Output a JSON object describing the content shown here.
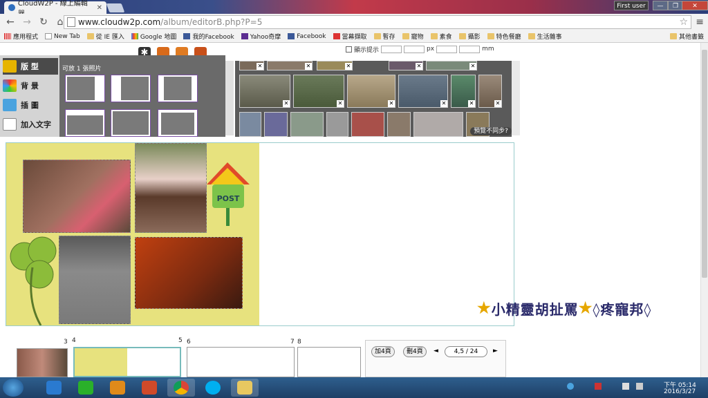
{
  "browser": {
    "tab_title": "CloudW2P - 線上編輯器",
    "url_host": "www.cloudw2p.com",
    "url_path": "/album/editorB.php?P=5",
    "user_button": "First user",
    "win_min": "—",
    "win_max": "❐",
    "win_close": "✕"
  },
  "bookmarks": [
    {
      "label": "應用程式",
      "icon": "apps-icon"
    },
    {
      "label": "New Tab",
      "icon": "page-icon"
    },
    {
      "label": "從 IE 匯入",
      "icon": "folder-icon"
    },
    {
      "label": "Google 地圖",
      "icon": "google-icon"
    },
    {
      "label": "我的Facebook",
      "icon": "facebook-icon"
    },
    {
      "label": "Yahoo奇摩",
      "icon": "yahoo-icon"
    },
    {
      "label": "Facebook",
      "icon": "facebook-icon"
    },
    {
      "label": "當幕擷取",
      "icon": "home-icon"
    },
    {
      "label": "暫存",
      "icon": "folder-icon"
    },
    {
      "label": "寵物",
      "icon": "folder-icon"
    },
    {
      "label": "素食",
      "icon": "folder-icon"
    },
    {
      "label": "攝影",
      "icon": "folder-icon"
    },
    {
      "label": "特色餐廳",
      "icon": "folder-icon"
    },
    {
      "label": "生活雜事",
      "icon": "folder-icon"
    }
  ],
  "other_bookmarks": "其他書籤",
  "editor": {
    "show_tips": "顯示提示",
    "unit_px": "px",
    "unit_mm": "mm",
    "nav": [
      {
        "label": "版 型"
      },
      {
        "label": "背 景"
      },
      {
        "label": "插 圖"
      },
      {
        "label": "加入文字"
      }
    ],
    "layout_caption": "可放 1 張照片",
    "preview_label": "預覽不同步?",
    "post_label": "POST"
  },
  "pages": {
    "numbers": [
      "3",
      "4",
      "5",
      "6",
      "7",
      "8"
    ],
    "add4": "加4頁",
    "del4": "刪4頁",
    "prev": "◄",
    "next": "►",
    "page_indicator": "4,5 / 24"
  },
  "watermark": {
    "star": "★",
    "text1": "小精靈胡扯罵",
    "text2": "◊疼寵邦◊"
  },
  "taskbar": {
    "time": "下午 05:14",
    "date": "2016/3/27"
  },
  "colors": {
    "page_bg": "#e7e27e",
    "accent_purple": "#7a4fa3",
    "taskbar": "#1e3f66"
  }
}
